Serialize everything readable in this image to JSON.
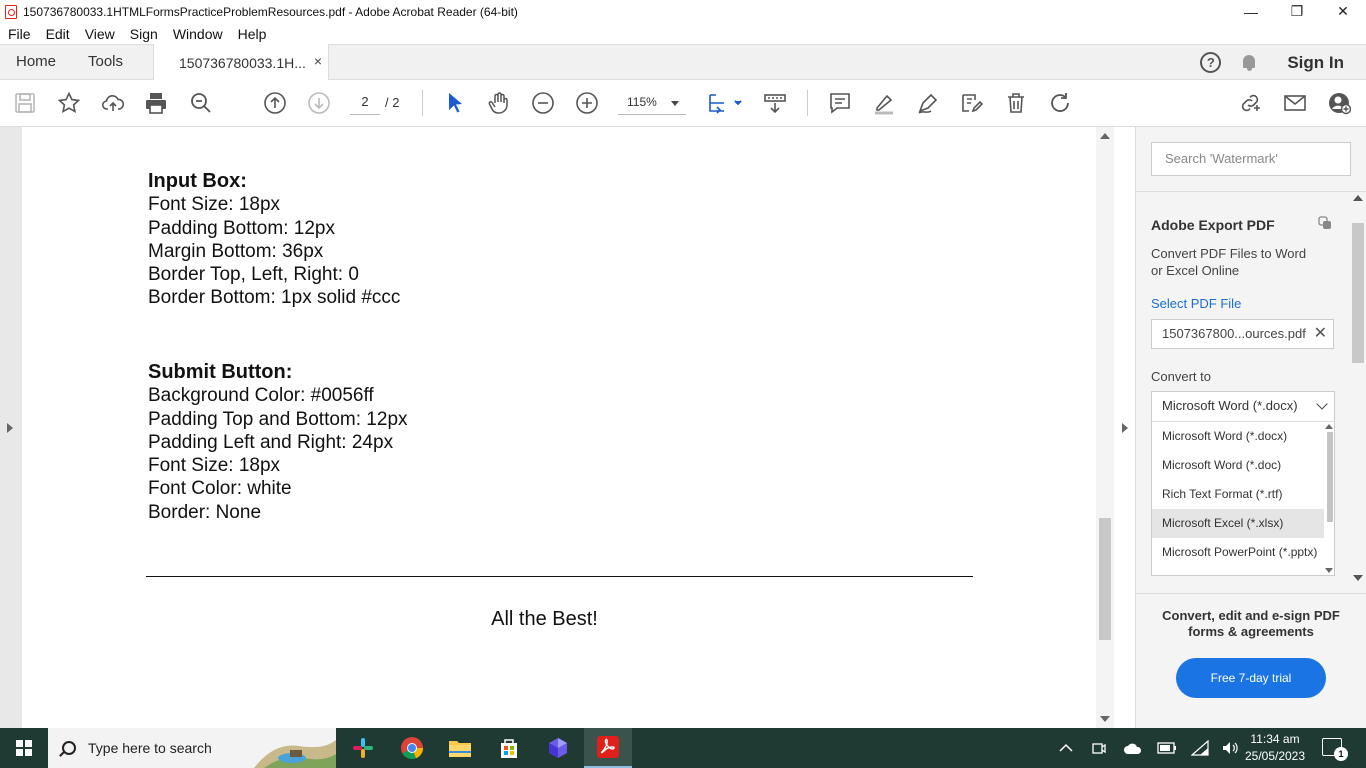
{
  "window": {
    "title": "150736780033.1HTMLFormsPracticeProblemResources.pdf - Adobe Acrobat Reader (64-bit)",
    "minimize": "—",
    "maximize": "❐",
    "close": "✕"
  },
  "menu": [
    "File",
    "Edit",
    "View",
    "Sign",
    "Window",
    "Help"
  ],
  "tabs": {
    "home": "Home",
    "tools": "Tools",
    "document": "150736780033.1H...",
    "close": "×",
    "help": "?",
    "sign_in": "Sign In"
  },
  "toolbar": {
    "current_page": "2",
    "total_pages": "/ 2",
    "zoom": "115%"
  },
  "document": {
    "input_box": {
      "heading": "Input Box:",
      "lines": [
        "Font Size: 18px",
        "Padding Bottom: 12px",
        "Margin Bottom: 36px",
        "Border Top, Left, Right: 0",
        "Border Bottom: 1px solid #ccc"
      ]
    },
    "submit_button": {
      "heading": "Submit Button:",
      "lines": [
        "Background Color: #0056ff",
        "Padding Top and Bottom: 12px",
        "Padding Left and Right: 24px",
        "Font Size: 18px",
        "Font Color: white",
        "Border: None"
      ]
    },
    "footer": "All the Best!"
  },
  "right_panel": {
    "search_placeholder": "Search 'Watermark'",
    "title": "Adobe Export PDF",
    "description": "Convert PDF Files to Word or Excel Online",
    "select_file_link": "Select PDF File",
    "selected_file": "1507367800...ources.pdf",
    "convert_to_label": "Convert to",
    "selected_format": "Microsoft Word (*.docx)",
    "format_options": [
      "Microsoft Word (*.docx)",
      "Microsoft Word (*.doc)",
      "Rich Text Format (*.rtf)",
      "Microsoft Excel (*.xlsx)",
      "Microsoft PowerPoint (*.pptx)"
    ],
    "highlighted_option_index": 3,
    "promo_text": "Convert, edit and e-sign PDF forms & agreements",
    "trial_button": "Free 7-day trial"
  },
  "taskbar": {
    "search_placeholder": "Type here to search",
    "time": "11:34 am",
    "date": "25/05/2023",
    "notification_count": "1"
  },
  "colors": {
    "accent_blue": "#1b74e4",
    "link_blue": "#1a6fd0",
    "acrobat_red": "#e0201a",
    "taskbar": "#1f3a33"
  }
}
